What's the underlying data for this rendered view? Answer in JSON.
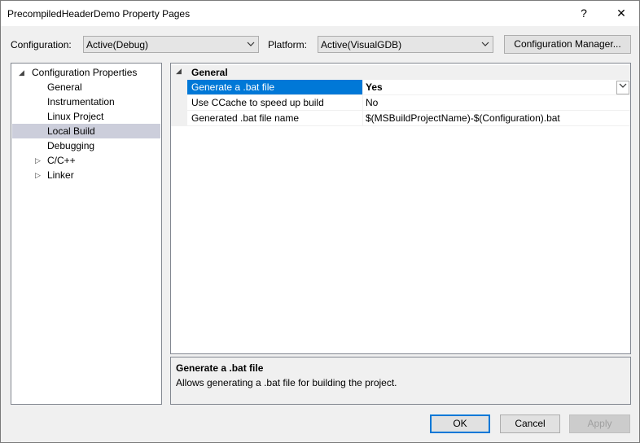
{
  "window": {
    "title": "PrecompiledHeaderDemo Property Pages",
    "help_glyph": "?",
    "close_glyph": "✕"
  },
  "toolbar": {
    "configuration_label": "Configuration:",
    "configuration_value": "Active(Debug)",
    "platform_label": "Platform:",
    "platform_value": "Active(VisualGDB)",
    "config_manager_label": "Configuration Manager..."
  },
  "tree": {
    "items": [
      {
        "label": "Configuration Properties",
        "expander": "expanded"
      },
      {
        "label": "General"
      },
      {
        "label": "Instrumentation"
      },
      {
        "label": "Linux Project"
      },
      {
        "label": "Local Build",
        "selected": true
      },
      {
        "label": "Debugging"
      },
      {
        "label": "C/C++",
        "expander": "collapsed"
      },
      {
        "label": "Linker",
        "expander": "collapsed"
      }
    ]
  },
  "grid": {
    "category": "General",
    "rows": [
      {
        "name": "Generate a .bat file",
        "value": "Yes",
        "selected": true
      },
      {
        "name": "Use CCache to speed up build",
        "value": "No"
      },
      {
        "name": "Generated .bat file name",
        "value": "$(MSBuildProjectName)-$(Configuration).bat"
      }
    ]
  },
  "description": {
    "title": "Generate a .bat file",
    "text": "Allows generating a .bat file for building the project."
  },
  "buttons": {
    "ok": "OK",
    "cancel": "Cancel",
    "apply": "Apply"
  },
  "colors": {
    "selection_blue": "#0078d7",
    "tree_selection": "#cccedb"
  }
}
